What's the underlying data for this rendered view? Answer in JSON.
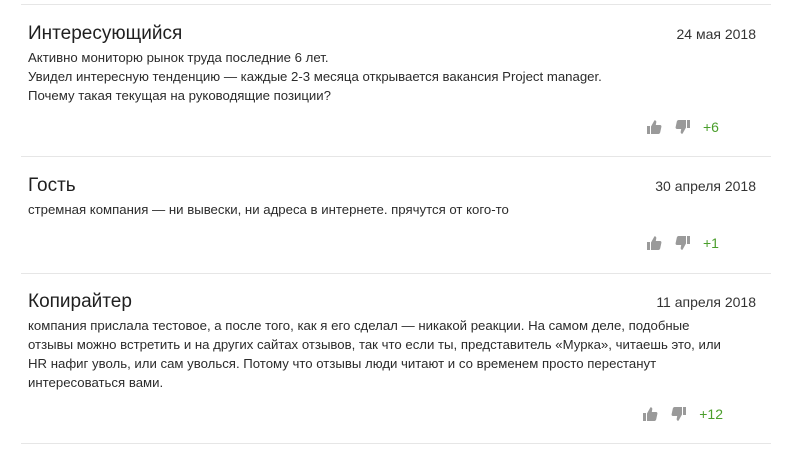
{
  "colors": {
    "divider": "#e6e6e6",
    "score": "#4a9e2b",
    "vote_icon": "#9a9a9a"
  },
  "reviews": [
    {
      "author": "Интересующийся",
      "date": "24 мая 2018",
      "lines": [
        "Активно мониторю рынок труда последние 6 лет.",
        "Увидел интересную тенденцию — каждые 2-3 месяца открывается вакансия Project manager.",
        "Почему такая текущая на руководящие позиции?"
      ],
      "score": "+6",
      "icons": {
        "up": "thumbs-up-icon",
        "down": "thumbs-down-icon"
      }
    },
    {
      "author": "Гость",
      "date": "30 апреля 2018",
      "lines": [
        "стремная компания — ни вывески, ни адреса в интернете. прячутся от кого-то"
      ],
      "score": "+1",
      "icons": {
        "up": "thumbs-up-icon",
        "down": "thumbs-down-icon"
      }
    },
    {
      "author": "Копирайтер",
      "date": "11 апреля 2018",
      "lines": [
        "компания прислала тестовое, а после того, как я его сделал — никакой реакции. На самом деле, подобные",
        "отзывы можно встретить и на других сайтах отзывов, так что если ты, представитель «Мурка», читаешь это, или",
        "HR нафиг уволь, или сам уволься. Потому что отзывы люди читают и со временем просто перестанут",
        "интересоваться вами."
      ],
      "score": "+12",
      "icons": {
        "up": "thumbs-up-icon",
        "down": "thumbs-down-icon"
      }
    }
  ]
}
